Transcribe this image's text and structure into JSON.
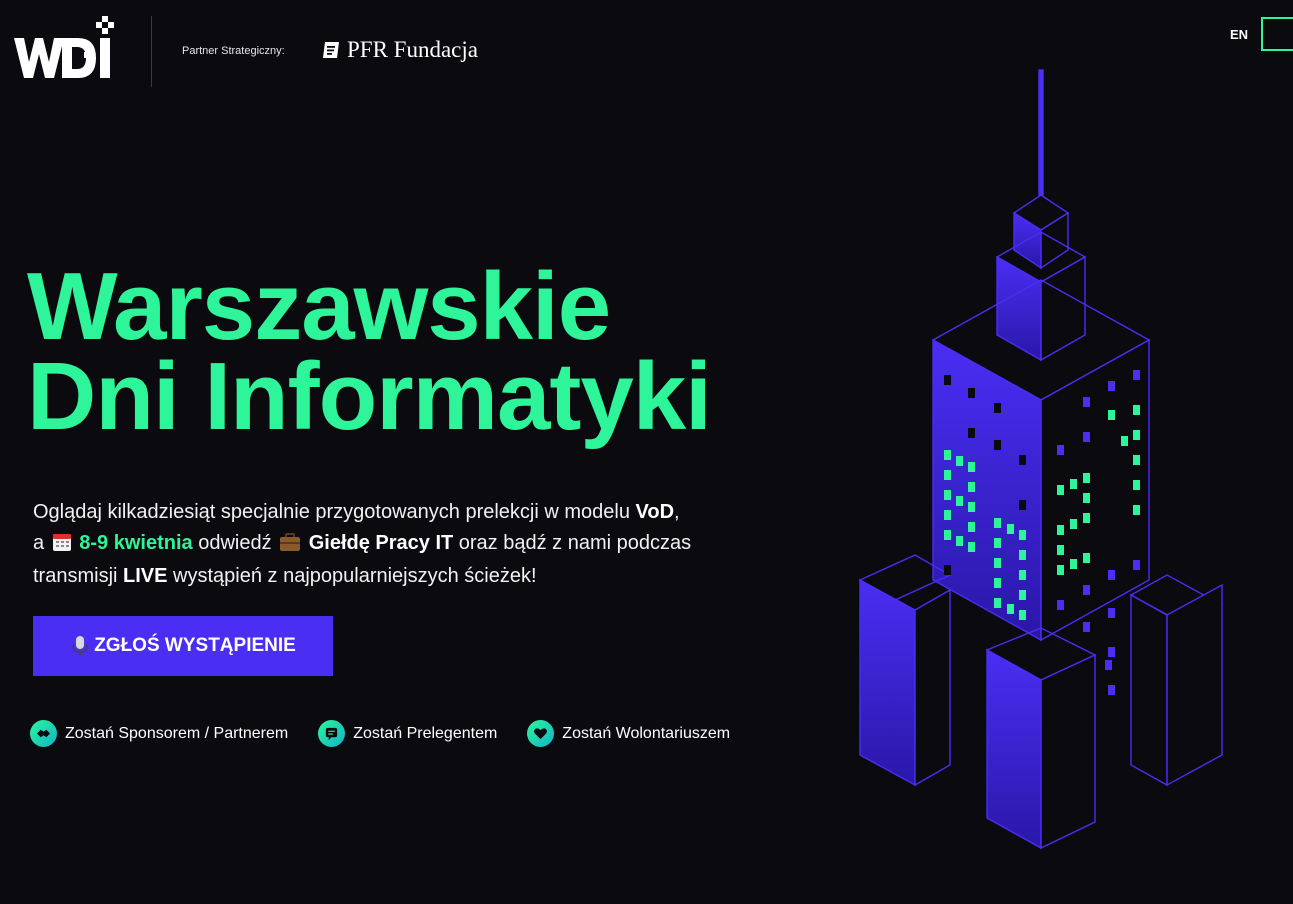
{
  "header": {
    "logo_alt": "WDI",
    "partner_label": "Partner Strategiczny:",
    "partner_name": "PFR Fundacja",
    "lang": "EN"
  },
  "hero": {
    "title_line1": "Warszawskie",
    "title_line2": "Dni Informatyki",
    "desc": {
      "p1": "Oglądaj kilkadziesiąt specjalnie przygotowanych prelekcji w modelu ",
      "vod": "VoD",
      "p2": ",",
      "p3": "a ",
      "date": "8-9 kwietnia",
      "p4": " odwiedź ",
      "job_fair": "Giełdę Pracy IT",
      "p5": " oraz bądź z nami podczas",
      "p6": "transmisji ",
      "live": "LIVE",
      "p7": " wystąpień z najpopularniejszych ścieżek!"
    },
    "cta_label": "ZGŁOŚ WYSTĄPIENIE"
  },
  "links": [
    {
      "label": "Zostań Sponsorem / Partnerem",
      "icon": "handshake-icon"
    },
    {
      "label": "Zostań Prelegentem",
      "icon": "chat-icon"
    },
    {
      "label": "Zostań Wolontariuszem",
      "icon": "heart-icon"
    }
  ],
  "colors": {
    "accent_green": "#2ef59a",
    "accent_purple": "#4a2ef4",
    "background": "#0b0a0f"
  }
}
